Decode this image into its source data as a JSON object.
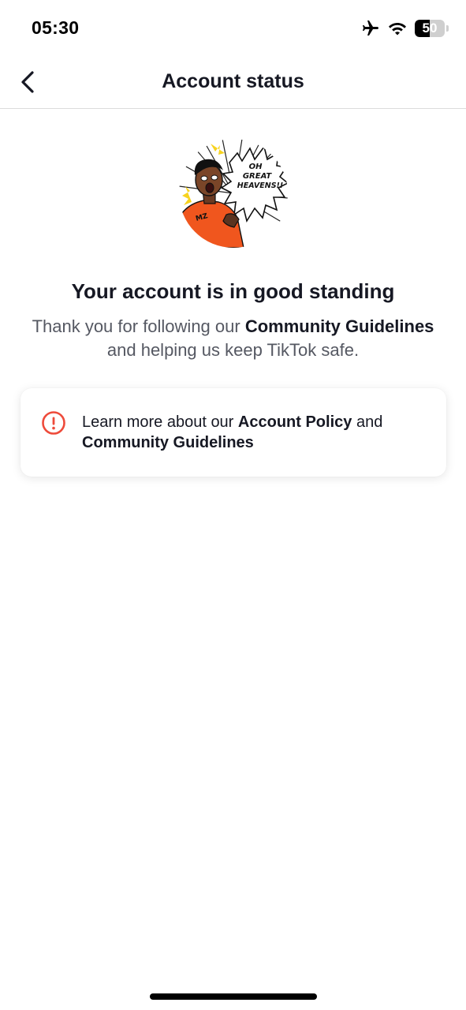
{
  "status_bar": {
    "time": "05:30",
    "battery_level": "50",
    "icons": [
      "airplane-icon",
      "wifi-icon",
      "battery-icon"
    ]
  },
  "nav": {
    "title": "Account status",
    "back_icon": "chevron-left-icon"
  },
  "avatar": {
    "bubble_text_line1": "OH",
    "bubble_text_line2": "GREAT",
    "bubble_text_line3": "HEAVENS!!"
  },
  "status": {
    "headline": "Your account is in good standing",
    "message_part1": "Thank you for following our ",
    "message_bold": "Community Guidelines",
    "message_part2": " and helping us keep TikTok safe."
  },
  "info_card": {
    "icon": "alert-circle-icon",
    "text_part1": "Learn more about our ",
    "link1": "Account Policy",
    "text_part2": " and ",
    "link2": "Community Guidelines"
  },
  "colors": {
    "accent_red": "#EE4B3B",
    "text_primary": "#161823",
    "text_secondary": "#555862",
    "hoodie_orange": "#F0561E"
  }
}
